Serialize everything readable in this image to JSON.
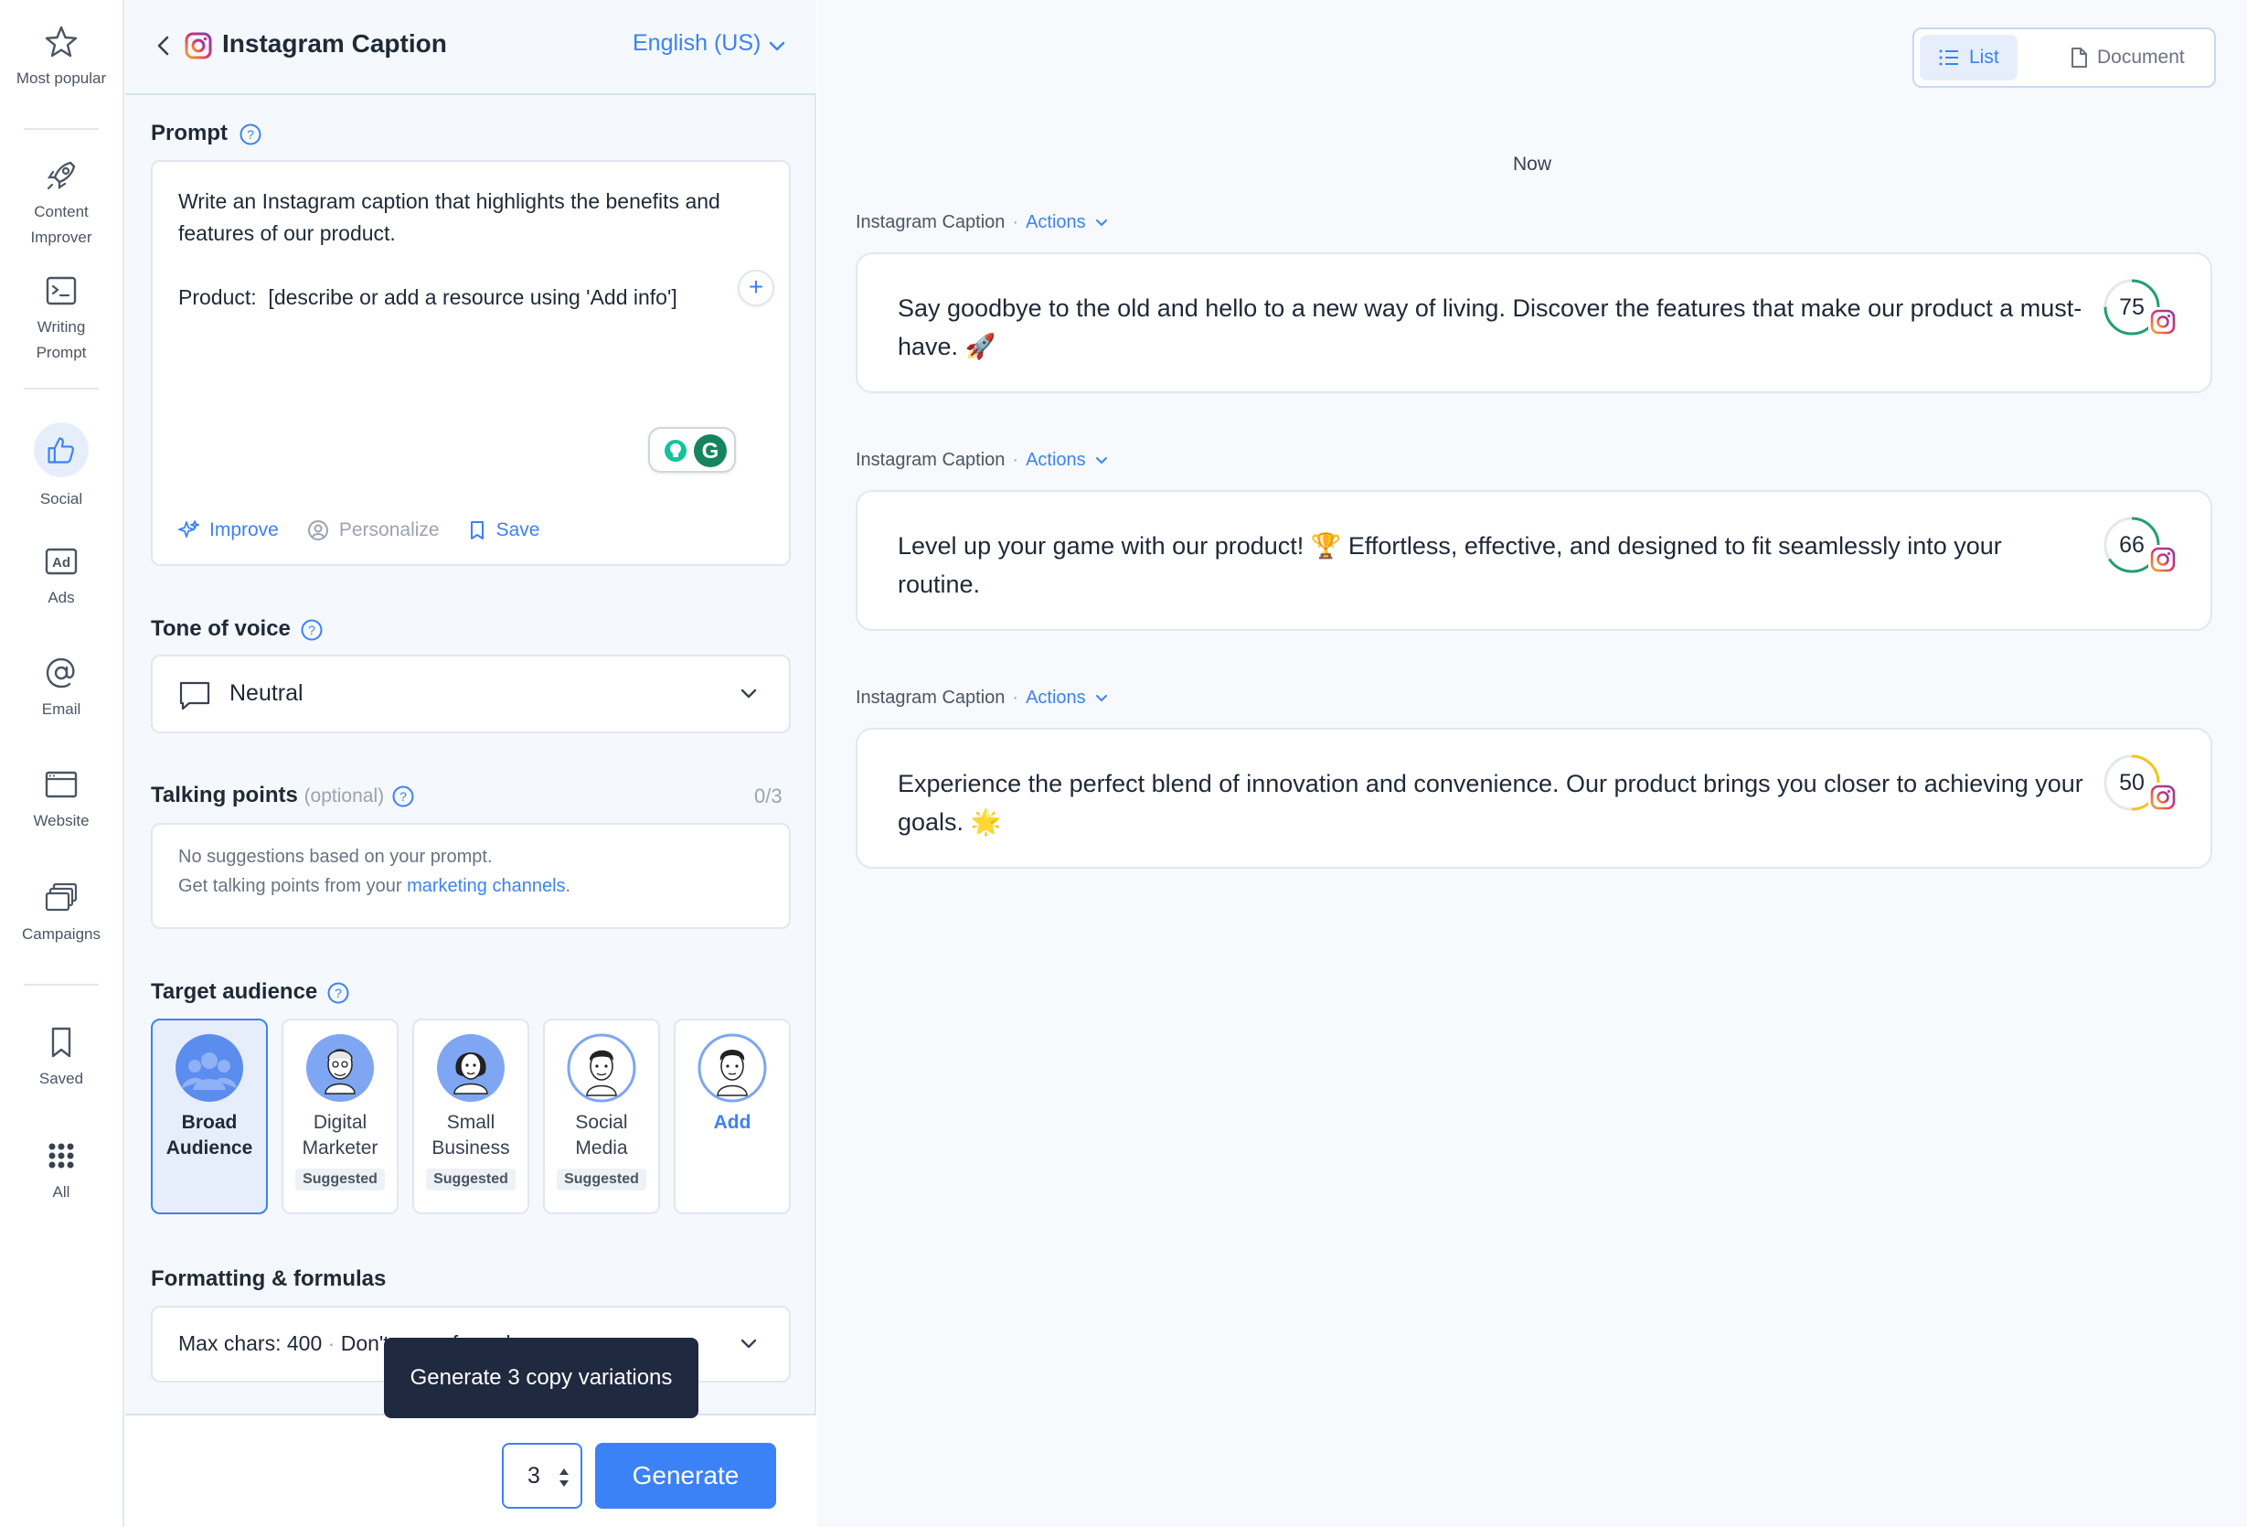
{
  "rail": {
    "items": [
      {
        "label": "Most popular",
        "icon": "star-icon"
      },
      {
        "label": "Content Improver",
        "icon": "rocket-icon"
      },
      {
        "label": "Writing Prompt",
        "icon": "terminal-icon"
      },
      {
        "label": "Social",
        "icon": "thumbs-up-icon"
      },
      {
        "label": "Ads",
        "icon": "ad-icon"
      },
      {
        "label": "Email",
        "icon": "at-icon"
      },
      {
        "label": "Website",
        "icon": "browser-icon"
      },
      {
        "label": "Campaigns",
        "icon": "campaigns-icon"
      },
      {
        "label": "Saved",
        "icon": "bookmark-icon"
      },
      {
        "label": "All",
        "icon": "grid-icon"
      }
    ]
  },
  "header": {
    "title": "Instagram Caption",
    "language": "English (US)"
  },
  "prompt": {
    "label": "Prompt",
    "text": "Write an Instagram caption that highlights the benefits and features of our product.\n\nProduct:  [describe or add a resource using 'Add info']",
    "actions": {
      "improve": "Improve",
      "personalize": "Personalize",
      "save": "Save"
    }
  },
  "tone": {
    "label": "Tone of voice",
    "value": "Neutral"
  },
  "talking_points": {
    "label": "Talking points",
    "optional": "(optional)",
    "count": "0/3",
    "line1": "No suggestions based on your prompt.",
    "line2_prefix": "Get talking points from your ",
    "line2_link": "marketing channels",
    "line2_suffix": "."
  },
  "audience": {
    "label": "Target audience",
    "options": [
      {
        "name_line1": "Broad",
        "name_line2": "Audience",
        "badge": "",
        "selected": true
      },
      {
        "name_line1": "Digital",
        "name_line2": "Marketer",
        "badge": "Suggested",
        "selected": false
      },
      {
        "name_line1": "Small",
        "name_line2": "Business",
        "badge": "Suggested",
        "selected": false
      },
      {
        "name_line1": "Social",
        "name_line2": "Media",
        "badge": "Suggested",
        "selected": false
      },
      {
        "name_line1": "Add",
        "name_line2": "",
        "badge": "",
        "selected": false
      }
    ]
  },
  "formatting": {
    "label": "Formatting & formulas",
    "value_a": "Max chars: 400",
    "value_sep": "·",
    "value_b": "Don't use a formula"
  },
  "footer": {
    "count": "3",
    "generate": "Generate",
    "tooltip": "Generate 3 copy variations"
  },
  "results": {
    "view_list": "List",
    "view_document": "Document",
    "timestamp": "Now",
    "items": [
      {
        "type": "Instagram Caption",
        "actions": "Actions",
        "text": "Say goodbye to the old and hello to a new way of living. Discover the features that make our product a must-have. 🚀",
        "score": 75,
        "score_color": "#22a06b"
      },
      {
        "type": "Instagram Caption",
        "actions": "Actions",
        "text": "Level up your game with our product! 🏆 Effortless, effective, and designed to fit seamlessly into your routine.",
        "score": 66,
        "score_color": "#22a06b"
      },
      {
        "type": "Instagram Caption",
        "actions": "Actions",
        "text": "Experience the perfect blend of innovation and convenience. Our product brings you closer to achieving your goals. 🌟",
        "score": 50,
        "score_color": "#f5c518"
      }
    ]
  },
  "colors": {
    "accent": "#3b82f6",
    "tooltip_bg": "#1f2940"
  }
}
